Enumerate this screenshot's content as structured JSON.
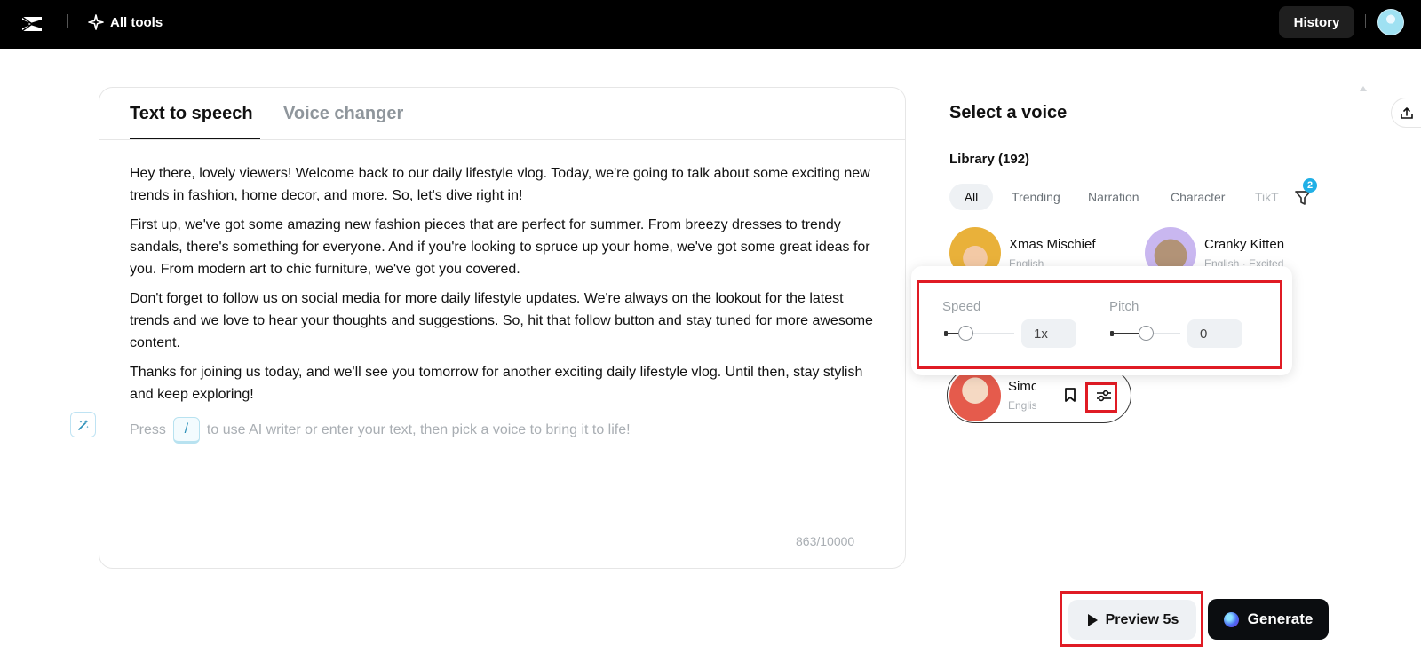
{
  "topbar": {
    "all_tools_label": "All tools",
    "history_label": "History"
  },
  "editor": {
    "tabs": [
      {
        "label": "Text to speech",
        "active": true
      },
      {
        "label": "Voice changer",
        "active": false
      }
    ],
    "paragraphs": [
      "Hey there, lovely viewers! Welcome back to our daily lifestyle vlog. Today, we're going to talk about some exciting new trends in fashion, home decor, and more. So, let's dive right in!",
      "First up, we've got some amazing new fashion pieces that are perfect for summer. From breezy dresses to trendy sandals, there's something for everyone. And if you're looking to spruce up your home, we've got some great ideas for you. From modern art to chic furniture, we've got you covered.",
      "Don't forget to follow us on social media for more daily lifestyle updates. We're always on the lookout for the latest trends and we love to hear your thoughts and suggestions. So, hit that follow button and stay tuned for more awesome content.",
      "Thanks for joining us today, and we'll see you tomorrow for another exciting daily lifestyle vlog. Until then, stay stylish and keep exploring!"
    ],
    "placeholder_before": "Press",
    "placeholder_key": "/",
    "placeholder_after": "to use AI writer or enter your text, then pick a voice to bring it to life!",
    "char_count": "863/10000"
  },
  "voice_panel": {
    "title": "Select a voice",
    "library_label": "Library (192)",
    "filters": [
      "All",
      "Trending",
      "Narration",
      "Character",
      "TikT"
    ],
    "filter_badge": "2",
    "voices": [
      {
        "name": "Xmas Mischief",
        "meta": "English"
      },
      {
        "name": "Cranky Kitten",
        "meta": "English · Excited"
      },
      {
        "name": "Simo",
        "meta": "English"
      }
    ]
  },
  "popover": {
    "speed_label": "Speed",
    "speed_value": "1x",
    "speed_fraction": 0.3,
    "pitch_label": "Pitch",
    "pitch_value": "0",
    "pitch_fraction": 0.5
  },
  "actions": {
    "preview_label": "Preview 5s",
    "generate_label": "Generate"
  },
  "colors": {
    "highlight": "#e01b24",
    "accent": "#21b0e6",
    "topbar": "#000000"
  }
}
